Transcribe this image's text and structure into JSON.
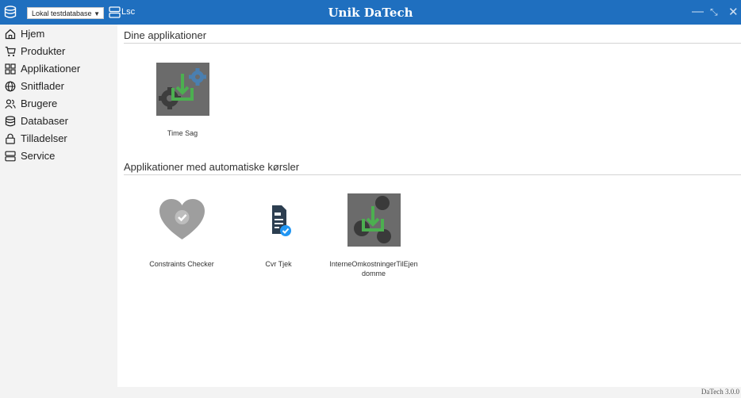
{
  "header": {
    "db_select_value": "Lokal testdatabase",
    "server_label": "Lsc",
    "app_title": "Unik DaTech"
  },
  "sidebar": {
    "items": [
      {
        "label": "Hjem",
        "icon": "home-icon"
      },
      {
        "label": "Produkter",
        "icon": "cart-icon"
      },
      {
        "label": "Applikationer",
        "icon": "grid-icon"
      },
      {
        "label": "Snitflader",
        "icon": "globe-icon"
      },
      {
        "label": "Brugere",
        "icon": "users-icon"
      },
      {
        "label": "Databaser",
        "icon": "database-icon"
      },
      {
        "label": "Tilladelser",
        "icon": "lock-icon"
      },
      {
        "label": "Service",
        "icon": "server-icon"
      }
    ]
  },
  "main": {
    "section1_title": "Dine applikationer",
    "section1_apps": [
      {
        "label": "Time Sag",
        "icon": "download-gears-icon"
      }
    ],
    "section2_title": "Applikationer med automatiske kørsler",
    "section2_apps": [
      {
        "label": "Constraints Checker",
        "icon": "heart-check-icon"
      },
      {
        "label": "Cvr Tjek",
        "icon": "document-check-icon"
      },
      {
        "label": "InterneOmkostningerTilEjen\ndomme",
        "icon": "download-tile-icon"
      }
    ]
  },
  "footer": {
    "version": "DaTech 3.0.0"
  },
  "colors": {
    "titlebar": "#1f6fbf",
    "accent_green": "#4caf50",
    "tile_gray": "#6b6b6b"
  }
}
